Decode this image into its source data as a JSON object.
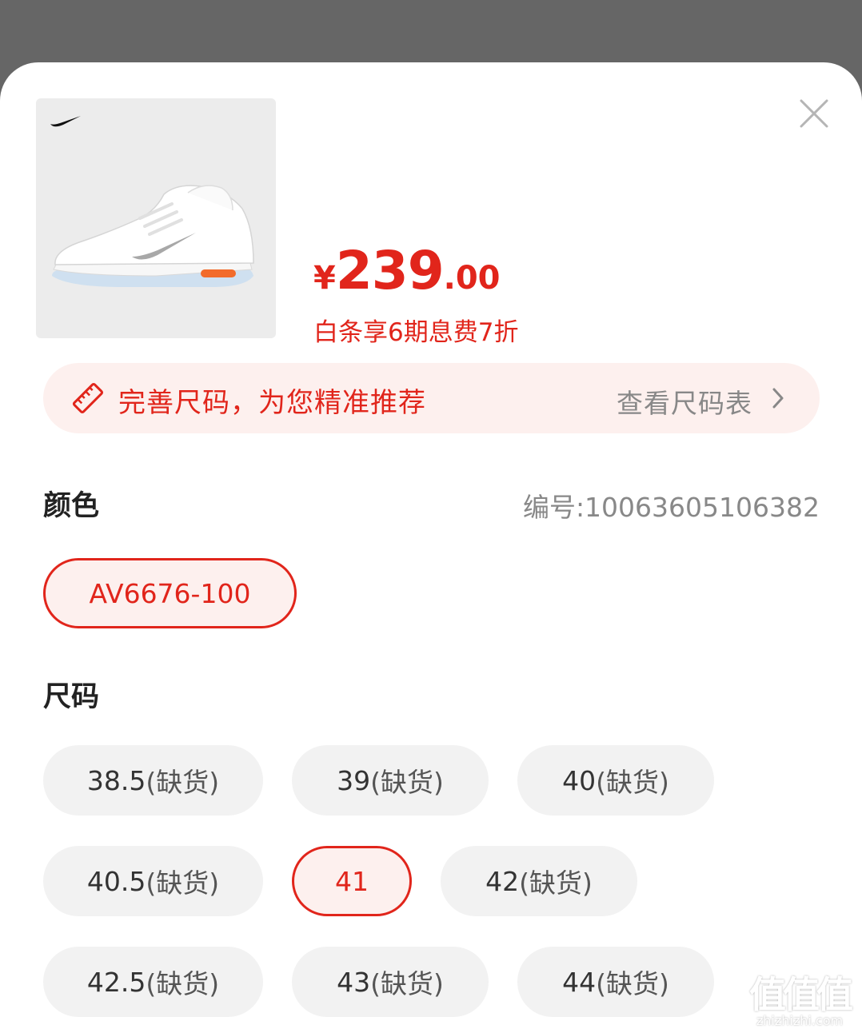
{
  "colors": {
    "accent": "#e1251b",
    "accent_bg": "#fdf0ee",
    "chip_bg": "#f2f2f2",
    "overlay": "#666666"
  },
  "product": {
    "image_alt": "shoe-product-image",
    "price_symbol": "¥",
    "price_integer": "239",
    "price_decimal": ".00",
    "installment_text": "白条享6期息费7折"
  },
  "size_banner": {
    "text": "完善尺码，为您精准推荐",
    "link_label": "查看尺码表"
  },
  "color_section": {
    "title": "颜色",
    "sku_label": "编号:10063605106382",
    "options": [
      {
        "label": "AV6676-100",
        "selected": true
      }
    ]
  },
  "size_section": {
    "title": "尺码",
    "options": [
      {
        "size": "38.5",
        "status": "(缺货)",
        "selected": false
      },
      {
        "size": "39",
        "status": "(缺货)",
        "selected": false
      },
      {
        "size": "40",
        "status": "(缺货)",
        "selected": false
      },
      {
        "size": "40.5",
        "status": "(缺货)",
        "selected": false
      },
      {
        "size": "41",
        "status": "",
        "selected": true
      },
      {
        "size": "42",
        "status": "(缺货)",
        "selected": false
      },
      {
        "size": "42.5",
        "status": "(缺货)",
        "selected": false
      },
      {
        "size": "43",
        "status": "(缺货)",
        "selected": false
      },
      {
        "size": "44",
        "status": "(缺货)",
        "selected": false
      }
    ]
  },
  "watermark": {
    "glyphs": "值值值",
    "url": "zhizhizhi.com"
  },
  "icons": {
    "close": "close-icon",
    "ruler": "ruler-icon",
    "chevron": "chevron-right-icon",
    "brand": "swoosh-logo-icon"
  }
}
